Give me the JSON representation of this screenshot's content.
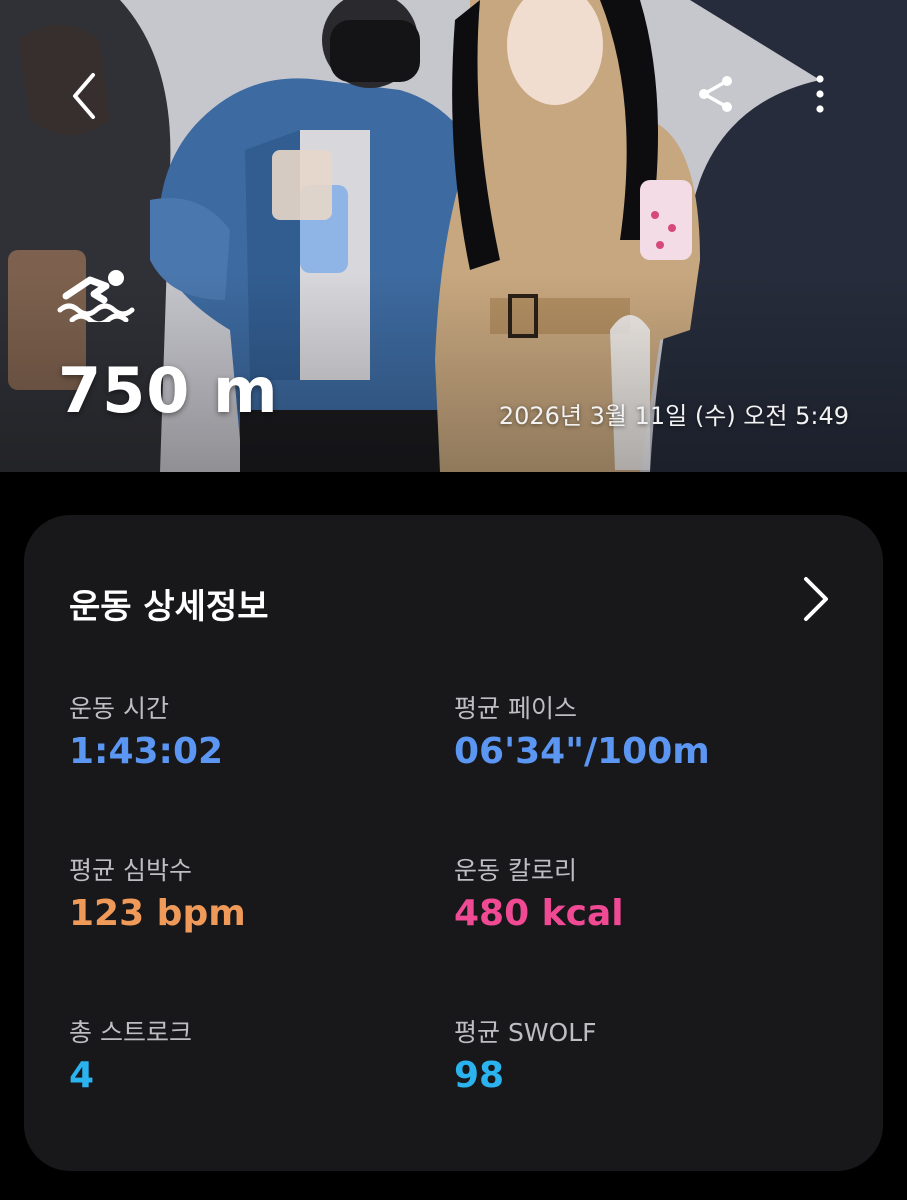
{
  "header": {
    "distance": "750 m",
    "datetime": "2026년 3월 11일 (수) 오전 5:49",
    "icons": {
      "back": "chevron-left-icon",
      "share": "share-icon",
      "more": "more-vertical-icon",
      "workout": "swimming-icon"
    }
  },
  "details": {
    "title": "운동 상세정보",
    "metrics": [
      {
        "label": "운동 시간",
        "value": "1:43:02",
        "color": "#5b96f2"
      },
      {
        "label": "평균 페이스",
        "value": "06'34\"/100m",
        "color": "#5b96f2"
      },
      {
        "label": "평균 심박수",
        "value": "123 bpm",
        "color": "#f09a5a"
      },
      {
        "label": "운동 칼로리",
        "value": "480 kcal",
        "color": "#ef4a93"
      },
      {
        "label": "총 스트로크",
        "value": "4",
        "color": "#2ab3ef"
      },
      {
        "label": "평균 SWOLF",
        "value": "98",
        "color": "#2ab3ef"
      }
    ]
  }
}
